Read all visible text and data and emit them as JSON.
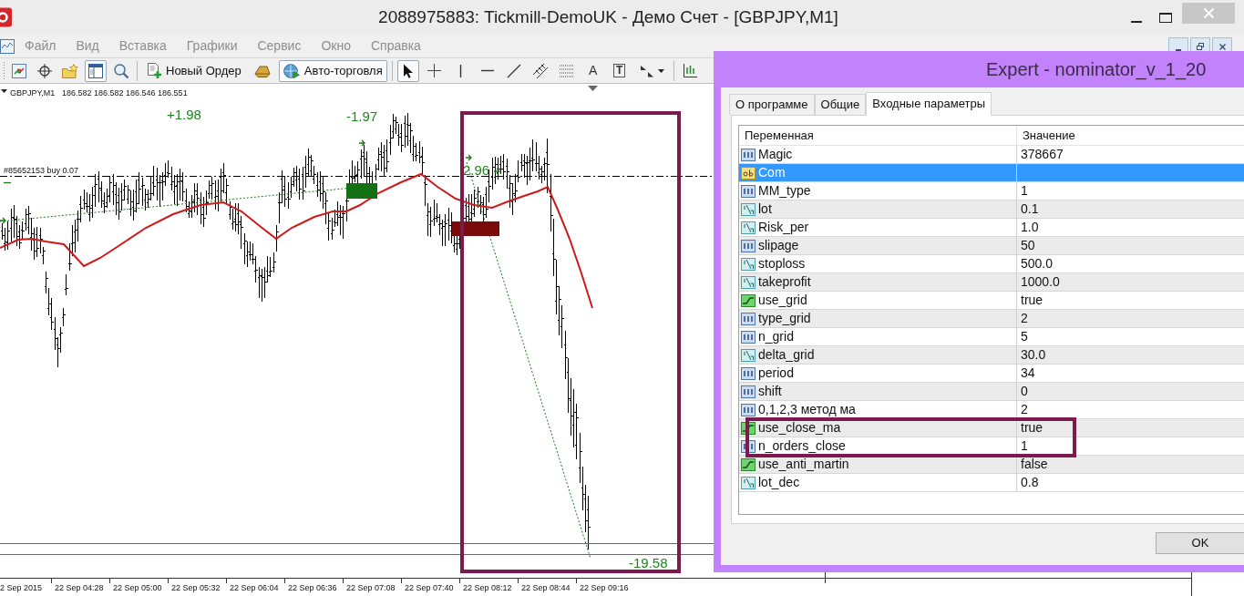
{
  "window": {
    "title": "2088975883: Tickmill-DemoUK - Демо Счет - [GBPJPY,M1]"
  },
  "menu": [
    {
      "label": "Файл",
      "disabled": true
    },
    {
      "label": "Вид",
      "disabled": true
    },
    {
      "label": "Вставка",
      "disabled": true
    },
    {
      "label": "Графики",
      "disabled": true
    },
    {
      "label": "Сервис",
      "disabled": true
    },
    {
      "label": "Окно",
      "disabled": true
    },
    {
      "label": "Справка",
      "disabled": true
    }
  ],
  "toolbar": {
    "groups": [
      [
        {
          "kind": "icon",
          "selected": false
        },
        {
          "kind": "icon",
          "selected": false
        },
        {
          "kind": "icon",
          "selected": false
        },
        {
          "kind": "icon",
          "selected": true
        },
        {
          "kind": "icon",
          "selected": false
        }
      ],
      [
        {
          "kind": "labeled",
          "label": "Новый Ордер",
          "selected": false
        },
        {
          "kind": "icon",
          "selected": false
        },
        {
          "kind": "labeled",
          "label": "Авто-торговля",
          "selected": true
        }
      ],
      [
        {
          "kind": "icon",
          "selected": true
        },
        {
          "kind": "icon",
          "selected": false
        },
        {
          "kind": "icon",
          "selected": false
        },
        {
          "kind": "icon",
          "selected": false
        },
        {
          "kind": "icon",
          "selected": false
        },
        {
          "kind": "icon",
          "selected": false
        },
        {
          "kind": "icon",
          "selected": false
        },
        {
          "kind": "glyph",
          "label": "A",
          "selected": false
        },
        {
          "kind": "framed-glyph",
          "label": "T",
          "selected": false
        },
        {
          "kind": "dropdown",
          "selected": false
        }
      ],
      [
        {
          "kind": "icon",
          "selected": false
        }
      ]
    ]
  },
  "chart": {
    "symbol": "GBPJPY,M1",
    "quotes": "186.582 186.582 186.546 186.551",
    "order_label": "#85652153 buy 0.07",
    "profit_labels": [
      "+1.98",
      "-1.97",
      "2.96",
      "-19.58"
    ],
    "time_axis": [
      "2 Sep 2015",
      "22 Sep 04:28",
      "22 Sep 05:00",
      "22 Sep 05:32",
      "22 Sep 06:04",
      "22 Sep 06:36",
      "22 Sep 07:08",
      "22 Sep 07:40",
      "22 Sep 08:12",
      "22 Sep 08:44",
      "22 Sep 09:16"
    ]
  },
  "dialog": {
    "title": "Expert - nominator_v_1_20",
    "tabs": [
      {
        "label": "О программе",
        "selected": false
      },
      {
        "label": "Общие",
        "selected": false
      },
      {
        "label": "Входные параметры",
        "selected": true
      }
    ],
    "columns": [
      "Переменная",
      "Значение"
    ],
    "rows": [
      {
        "kind": "int",
        "name": "Magic",
        "value": "378667",
        "selected": false
      },
      {
        "kind": "string",
        "name": "Com",
        "selected": true
      },
      {
        "kind": "int",
        "name": "MM_type",
        "value": "1",
        "selected": false
      },
      {
        "kind": "double",
        "name": "lot",
        "value": "0.1",
        "selected": false
      },
      {
        "kind": "double",
        "name": "Risk_per",
        "value": "1.0",
        "selected": false
      },
      {
        "kind": "int",
        "name": "slipage",
        "value": "50",
        "selected": false
      },
      {
        "kind": "double",
        "name": "stoploss",
        "value": "500.0",
        "selected": false
      },
      {
        "kind": "double",
        "name": "takeprofit",
        "value": "1000.0",
        "selected": false
      },
      {
        "kind": "bool",
        "name": "use_grid",
        "value": "true",
        "selected": false
      },
      {
        "kind": "int",
        "name": "type_grid",
        "value": "2",
        "selected": false
      },
      {
        "kind": "int",
        "name": "n_grid",
        "value": "5",
        "selected": false
      },
      {
        "kind": "double",
        "name": "delta_grid",
        "value": "30.0",
        "selected": false
      },
      {
        "kind": "int",
        "name": "period",
        "value": "34",
        "selected": false
      },
      {
        "kind": "int",
        "name": "shift",
        "value": "0",
        "selected": false
      },
      {
        "kind": "int",
        "name": "0,1,2,3 метод ма",
        "value": "2",
        "selected": false
      },
      {
        "kind": "bool",
        "name": "use_close_ma",
        "value": "true",
        "selected": false
      },
      {
        "kind": "int",
        "name": "n_orders_close",
        "value": "1",
        "selected": false
      },
      {
        "kind": "bool",
        "name": "use_anti_martin",
        "value": "false",
        "selected": false
      },
      {
        "kind": "double",
        "name": "lot_dec",
        "value": "0.8",
        "selected": false
      }
    ],
    "buttons": [
      {
        "label": "OK"
      }
    ]
  }
}
